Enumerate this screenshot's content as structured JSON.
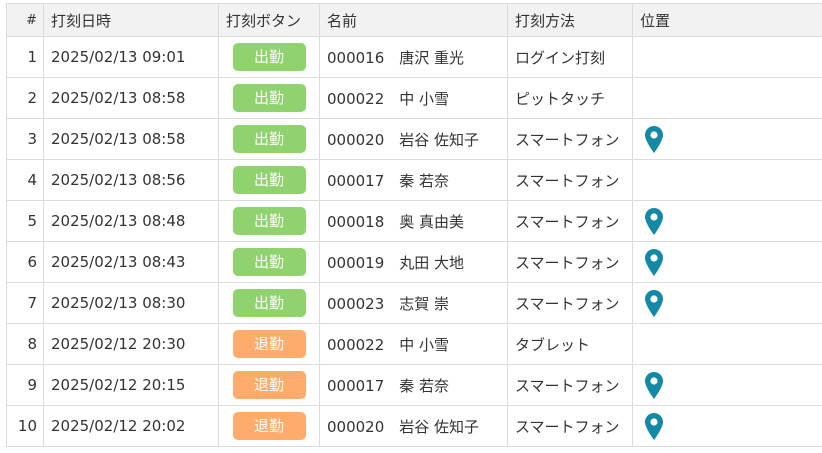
{
  "table": {
    "headers": {
      "num": "#",
      "datetime": "打刻日時",
      "button": "打刻ボタン",
      "name": "名前",
      "method": "打刻方法",
      "location": "位置"
    },
    "colors": {
      "in": "#8fd26e",
      "out": "#ffab6b",
      "pin": "#1389a5"
    },
    "rows": [
      {
        "num": "1",
        "datetime": "2025/02/13 09:01",
        "button": "出勤",
        "type": "in",
        "name": "000016　唐沢 重光",
        "method": "ログイン打刻",
        "location": false
      },
      {
        "num": "2",
        "datetime": "2025/02/13 08:58",
        "button": "出勤",
        "type": "in",
        "name": "000022　中 小雪",
        "method": "ピットタッチ",
        "location": false
      },
      {
        "num": "3",
        "datetime": "2025/02/13 08:58",
        "button": "出勤",
        "type": "in",
        "name": "000020　岩谷 佐知子",
        "method": "スマートフォン",
        "location": true
      },
      {
        "num": "4",
        "datetime": "2025/02/13 08:56",
        "button": "出勤",
        "type": "in",
        "name": "000017　秦 若奈",
        "method": "スマートフォン",
        "location": false
      },
      {
        "num": "5",
        "datetime": "2025/02/13 08:48",
        "button": "出勤",
        "type": "in",
        "name": "000018　奥 真由美",
        "method": "スマートフォン",
        "location": true
      },
      {
        "num": "6",
        "datetime": "2025/02/13 08:43",
        "button": "出勤",
        "type": "in",
        "name": "000019　丸田 大地",
        "method": "スマートフォン",
        "location": true
      },
      {
        "num": "7",
        "datetime": "2025/02/13 08:30",
        "button": "出勤",
        "type": "in",
        "name": "000023　志賀 崇",
        "method": "スマートフォン",
        "location": true
      },
      {
        "num": "8",
        "datetime": "2025/02/12 20:30",
        "button": "退勤",
        "type": "out",
        "name": "000022　中 小雪",
        "method": "タブレット",
        "location": false
      },
      {
        "num": "9",
        "datetime": "2025/02/12 20:15",
        "button": "退勤",
        "type": "out",
        "name": "000017　秦 若奈",
        "method": "スマートフォン",
        "location": true
      },
      {
        "num": "10",
        "datetime": "2025/02/12 20:02",
        "button": "退勤",
        "type": "out",
        "name": "000020　岩谷 佐知子",
        "method": "スマートフォン",
        "location": true
      }
    ]
  }
}
